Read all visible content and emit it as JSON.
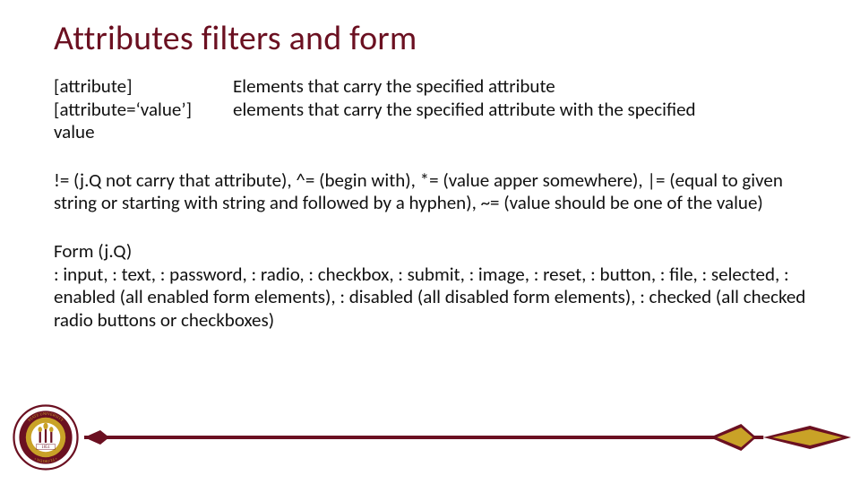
{
  "title": "Attributes filters and form",
  "defs": {
    "attr_label": "[attribute]",
    "attr_desc": "Elements that carry the specified attribute",
    "attrval_label": "[attribute=‘value’]",
    "attrval_desc": "elements that carry the specified attribute with the specified",
    "value_word": "value"
  },
  "operators_text": "!= (j.Q not carry that attribute), ^= (begin with), *= (value apper somewhere), |= (equal to given string or starting with string and followed by a hyphen), ~= (value should be one of the value)",
  "form_heading": "Form  (j.Q)",
  "form_list": ": input, : text, : password, : radio, : checkbox, : submit, : image, : reset, : button, : file, : selected, : enabled (all enabled form elements), : disabled (all disabled form elements), : checked (all checked radio buttons or checkboxes)",
  "seal": {
    "top_text": "STATE UNIVERSITY",
    "bottom_text": "FLORIDA",
    "year": "1851"
  },
  "colors": {
    "garnet": "#6b1021",
    "gold": "#c9a227"
  }
}
